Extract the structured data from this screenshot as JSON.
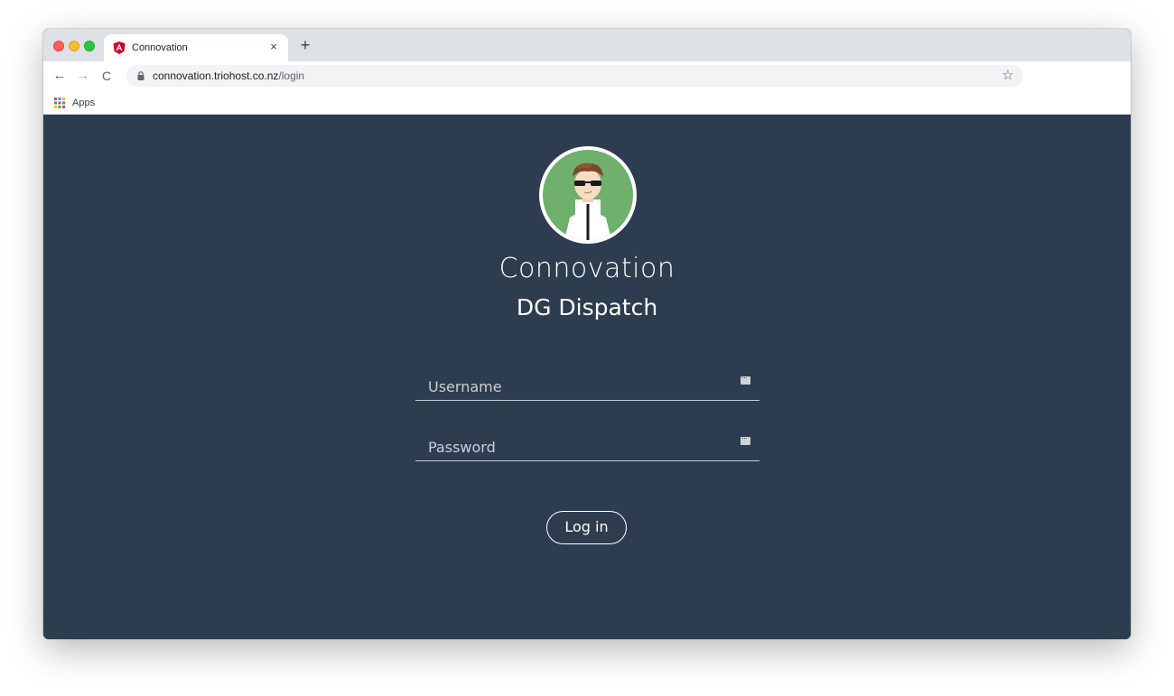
{
  "browser": {
    "tab": {
      "title": "Connovation",
      "favicon": "angular-icon",
      "close_glyph": "×"
    },
    "new_tab_glyph": "+",
    "nav": {
      "back_glyph": "←",
      "forward_glyph": "→",
      "reload_glyph": "C"
    },
    "url": {
      "host": "connovation.triohost.co.nz",
      "path": "/login"
    },
    "star_glyph": "☆",
    "bookmarks": {
      "apps_label": "Apps"
    }
  },
  "page": {
    "title": "Connovation",
    "subtitle": "DG Dispatch",
    "username": {
      "placeholder": "Username",
      "value": ""
    },
    "password": {
      "placeholder": "Password",
      "value": ""
    },
    "login_label": "Log in"
  },
  "colors": {
    "page_background": "#2e3c4f",
    "avatar_background": "#6fb06c",
    "accent_text": "#ffffff"
  }
}
